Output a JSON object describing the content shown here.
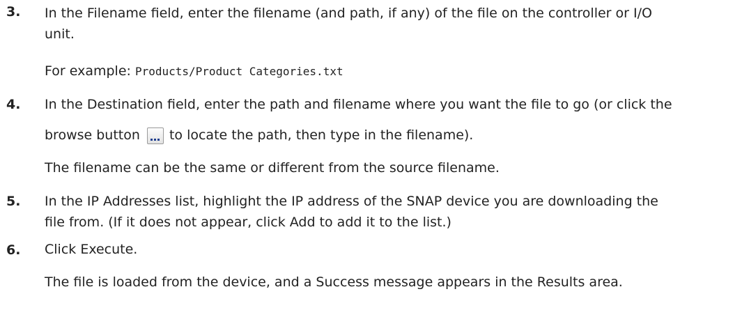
{
  "steps": [
    {
      "number": "3.",
      "text_line1": "In the Filename field, enter the filename (and path, if any) of the file on the controller or I/O",
      "text_line2": "unit."
    },
    {
      "number": "4.",
      "text_line1": "In the Destination field, enter the path and filename where you want the file to go (or click the",
      "text_line2_before": "browse button",
      "text_line2_after": "to locate the path, then type in the filename)."
    },
    {
      "number": "5.",
      "text_line1": "In the IP Addresses list, highlight the IP address of the SNAP device you are downloading the",
      "text_line2": "file from. (If it does not appear, click Add to add it to the list.)"
    },
    {
      "number": "6.",
      "text_line1": "Click Execute."
    }
  ],
  "example": {
    "label": "For example:",
    "code": "Products/Product Categories.txt"
  },
  "notes": {
    "filename_same": "The filename can be the same or different from the source filename.",
    "file_loaded": "The file is loaded from the device, and a Success message appears in the Results area."
  },
  "icons": {
    "browse_button": "browse-ellipsis-icon"
  }
}
